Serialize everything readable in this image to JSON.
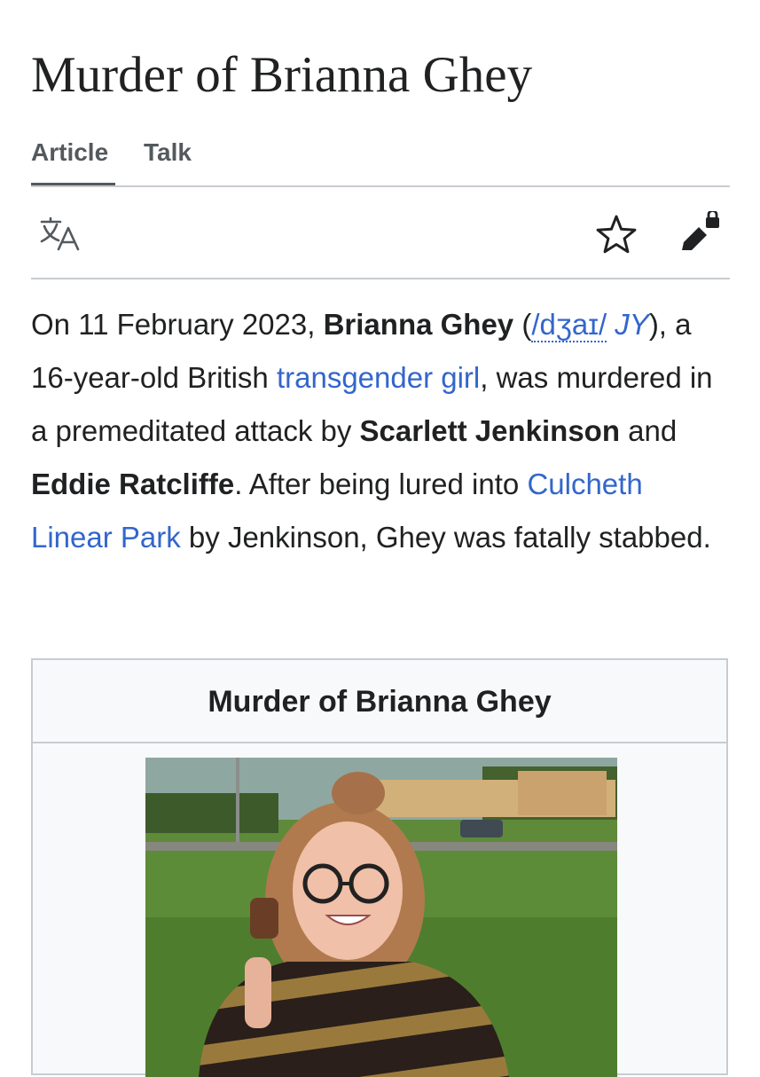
{
  "article": {
    "title": "Murder of Brianna Ghey"
  },
  "tabs": {
    "article": "Article",
    "talk": "Talk"
  },
  "toolbar": {
    "icons": [
      "language-icon",
      "star-icon",
      "edit-lock-icon"
    ]
  },
  "lead": {
    "t1": "On 11 February 2023, ",
    "name": "Brianna Ghey",
    "t2": " (",
    "ipa": "/dʒaɪ/",
    "t3": " ",
    "respell": "JY",
    "t4": "), a 16-year-old British ",
    "link1": "transgender girl",
    "t5": ", was murdered in a premeditated attack by ",
    "perp1": "Scarlett Jenkinson",
    "t6": " and ",
    "perp2": "Eddie Ratcliffe",
    "t7": ". After being lured into ",
    "link2": "Culcheth Linear Park",
    "t8": " by Jenkinson, Ghey was fatally stabbed."
  },
  "infobox": {
    "title": "Murder of Brianna Ghey"
  },
  "colors": {
    "link": "#3366cc",
    "text": "#202122",
    "tab": "#54595d",
    "border": "#c8ccd1",
    "infobox_bg": "#f8f9fa"
  }
}
